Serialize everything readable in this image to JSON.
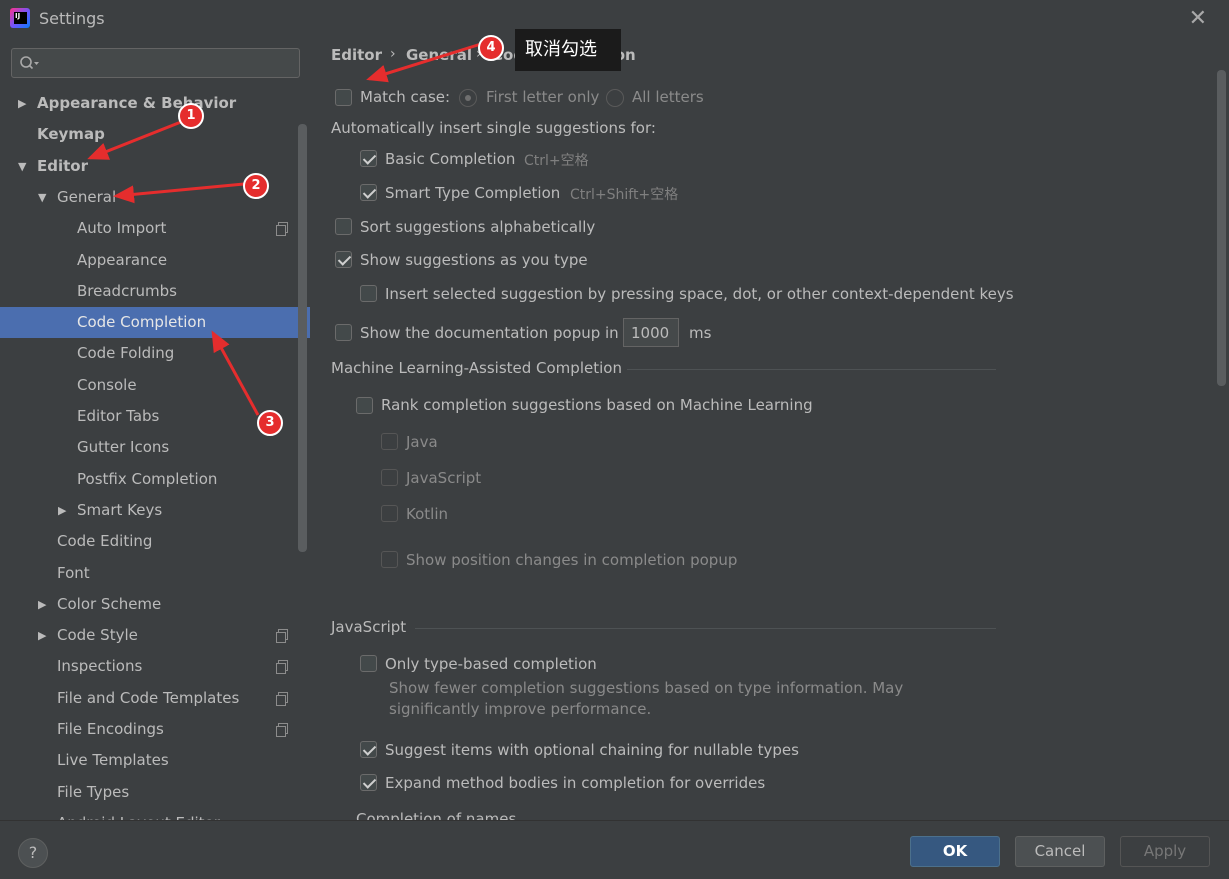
{
  "window": {
    "title": "Settings",
    "close_glyph": "✕"
  },
  "search": {
    "placeholder": ""
  },
  "tree": [
    {
      "label": "Appearance & Behavior",
      "arrow": "▶",
      "bold": true
    },
    {
      "label": "Keymap",
      "arrow": "",
      "bold": true
    },
    {
      "label": "Editor",
      "arrow": "▼",
      "bold": true
    },
    {
      "label": "General",
      "arrow": "▼",
      "bold": false
    },
    {
      "label": "Auto Import",
      "arrow": "",
      "bold": false,
      "copy": true
    },
    {
      "label": "Appearance",
      "arrow": "",
      "bold": false
    },
    {
      "label": "Breadcrumbs",
      "arrow": "",
      "bold": false
    },
    {
      "label": "Code Completion",
      "arrow": "",
      "bold": false,
      "selected": true
    },
    {
      "label": "Code Folding",
      "arrow": "",
      "bold": false
    },
    {
      "label": "Console",
      "arrow": "",
      "bold": false
    },
    {
      "label": "Editor Tabs",
      "arrow": "",
      "bold": false
    },
    {
      "label": "Gutter Icons",
      "arrow": "",
      "bold": false
    },
    {
      "label": "Postfix Completion",
      "arrow": "",
      "bold": false
    },
    {
      "label": "Smart Keys",
      "arrow": "▶",
      "bold": false
    },
    {
      "label": "Code Editing",
      "arrow": "",
      "bold": false
    },
    {
      "label": "Font",
      "arrow": "",
      "bold": false
    },
    {
      "label": "Color Scheme",
      "arrow": "▶",
      "bold": false
    },
    {
      "label": "Code Style",
      "arrow": "▶",
      "bold": false,
      "copy": true
    },
    {
      "label": "Inspections",
      "arrow": "",
      "bold": false,
      "copy": true
    },
    {
      "label": "File and Code Templates",
      "arrow": "",
      "bold": false,
      "copy": true
    },
    {
      "label": "File Encodings",
      "arrow": "",
      "bold": false,
      "copy": true
    },
    {
      "label": "Live Templates",
      "arrow": "",
      "bold": false
    },
    {
      "label": "File Types",
      "arrow": "",
      "bold": false
    },
    {
      "label": "Android Layout Editor",
      "arrow": "",
      "bold": false
    }
  ],
  "breadcrumb": {
    "editor": "Editor",
    "general": "General",
    "page": "Code Completion",
    "sep": "›"
  },
  "tooltip": "取消勾选",
  "settings": {
    "match_case": "Match case:",
    "first_letter_only": "First letter only",
    "all_letters": "All letters",
    "auto_insert": "Automatically insert single suggestions for:",
    "basic_completion": "Basic Completion",
    "basic_shortcut": "Ctrl+空格",
    "smart_type": "Smart Type Completion",
    "smart_shortcut": "Ctrl+Shift+空格",
    "sort_alpha": "Sort suggestions alphabetically",
    "show_as_type": "Show suggestions as you type",
    "insert_selected": "Insert selected suggestion by pressing space, dot, or other context-dependent keys",
    "doc_popup": "Show the documentation popup in",
    "doc_popup_value": "1000",
    "doc_popup_unit": "ms",
    "ml_section": "Machine Learning-Assisted Completion",
    "ml_rank": "Rank completion suggestions based on Machine Learning",
    "ml_java": "Java",
    "ml_js": "JavaScript",
    "ml_kotlin": "Kotlin",
    "ml_position": "Show position changes in completion popup",
    "js_section": "JavaScript",
    "js_type_based": "Only type-based completion",
    "js_type_based_desc1": "Show fewer completion suggestions based on type information. May",
    "js_type_based_desc2": "significantly improve performance.",
    "js_optional_chaining": "Suggest items with optional chaining for nullable types",
    "js_expand_bodies": "Expand method bodies in completion for overrides",
    "completion_names": "Completion of names"
  },
  "footer": {
    "help": "?",
    "ok": "OK",
    "cancel": "Cancel",
    "apply": "Apply"
  },
  "annotations": [
    "1",
    "2",
    "3",
    "4"
  ],
  "colors": {
    "accent": "#4b6eaf",
    "ok_button": "#365880",
    "annotation": "#e52d2d"
  }
}
